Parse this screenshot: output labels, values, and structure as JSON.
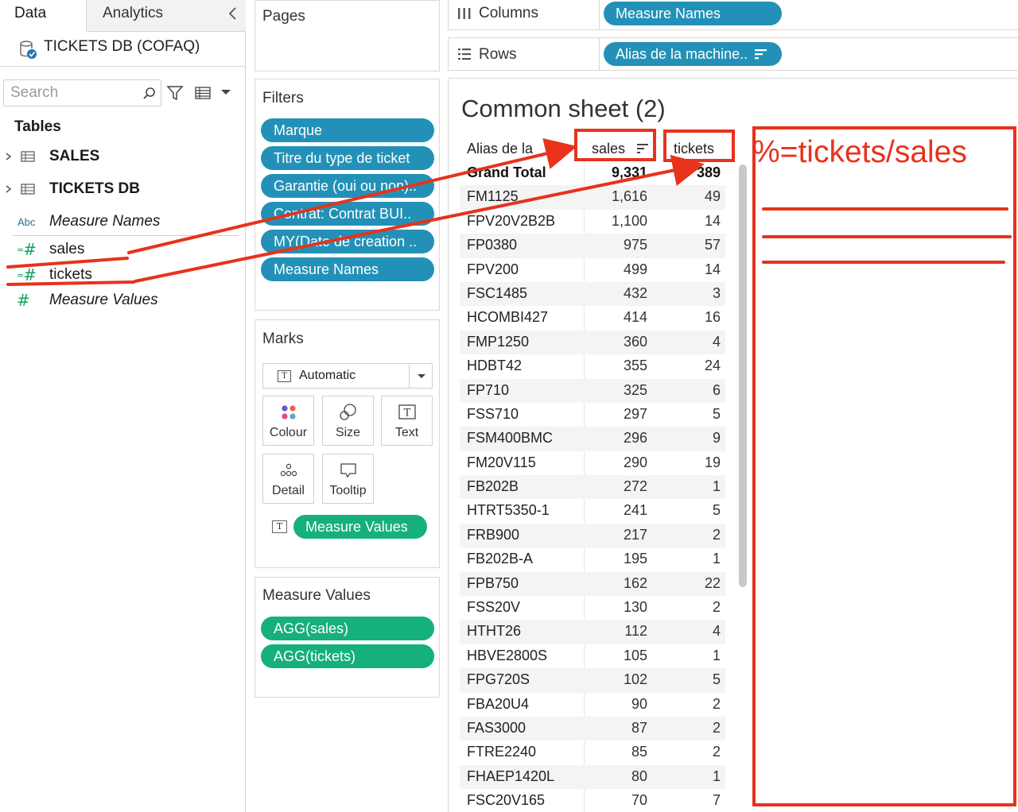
{
  "data_pane": {
    "tab_data": "Data",
    "tab_analytics": "Analytics",
    "datasource": "TICKETS DB (COFAQ)",
    "search_placeholder": "Search",
    "tables_label": "Tables",
    "tables": [
      "SALES",
      "TICKETS DB"
    ],
    "fields": [
      {
        "type": "dimension",
        "label": "Measure Names"
      },
      {
        "type": "calculated-measure",
        "label": "sales"
      },
      {
        "type": "calculated-measure",
        "label": "tickets"
      },
      {
        "type": "measure",
        "label": "Measure Values"
      }
    ],
    "abc_badge": "Abc"
  },
  "shelves": {
    "pages_title": "Pages",
    "filters_title": "Filters",
    "filters": [
      "Marque",
      "Titre du type de ticket",
      "Garantie (oui ou non)..",
      "Contrat: Contrat BUI..",
      "MY(Date de creation ..",
      "Measure Names"
    ],
    "marks_title": "Marks",
    "mark_type": "Automatic",
    "mark_buttons": [
      "Colour",
      "Size",
      "Text",
      "Detail",
      "Tooltip"
    ],
    "text_badge": "T",
    "marks_pill": "Measure Values",
    "measure_values_title": "Measure Values",
    "measure_values": [
      "AGG(sales)",
      "AGG(tickets)"
    ],
    "columns_label": "Columns",
    "columns_pill": "Measure Names",
    "rows_label": "Rows",
    "rows_pill": "Alias de la machine.."
  },
  "view": {
    "sheet_title": "Common sheet (2)",
    "headers": {
      "alias": "Alias de la",
      "sales": "sales",
      "tickets": "tickets"
    },
    "rows": [
      {
        "alias": "Grand Total",
        "sales": "9,331",
        "tickets": "389"
      },
      {
        "alias": "FM1125",
        "sales": "1,616",
        "tickets": "49"
      },
      {
        "alias": "FPV20V2B2B",
        "sales": "1,100",
        "tickets": "14"
      },
      {
        "alias": "FP0380",
        "sales": "975",
        "tickets": "57"
      },
      {
        "alias": "FPV200",
        "sales": "499",
        "tickets": "14"
      },
      {
        "alias": "FSC1485",
        "sales": "432",
        "tickets": "3"
      },
      {
        "alias": "HCOMBI427",
        "sales": "414",
        "tickets": "16"
      },
      {
        "alias": "FMP1250",
        "sales": "360",
        "tickets": "4"
      },
      {
        "alias": "HDBT42",
        "sales": "355",
        "tickets": "24"
      },
      {
        "alias": "FP710",
        "sales": "325",
        "tickets": "6"
      },
      {
        "alias": "FSS710",
        "sales": "297",
        "tickets": "5"
      },
      {
        "alias": "FSM400BMC",
        "sales": "296",
        "tickets": "9"
      },
      {
        "alias": "FM20V115",
        "sales": "290",
        "tickets": "19"
      },
      {
        "alias": "FB202B",
        "sales": "272",
        "tickets": "1"
      },
      {
        "alias": "HTRT5350-1",
        "sales": "241",
        "tickets": "5"
      },
      {
        "alias": "FRB900",
        "sales": "217",
        "tickets": "2"
      },
      {
        "alias": "FB202B-A",
        "sales": "195",
        "tickets": "1"
      },
      {
        "alias": "FPB750",
        "sales": "162",
        "tickets": "22"
      },
      {
        "alias": "FSS20V",
        "sales": "130",
        "tickets": "2"
      },
      {
        "alias": "HTHT26",
        "sales": "112",
        "tickets": "4"
      },
      {
        "alias": "HBVE2800S",
        "sales": "105",
        "tickets": "1"
      },
      {
        "alias": "FPG720S",
        "sales": "102",
        "tickets": "5"
      },
      {
        "alias": "FBA20U4",
        "sales": "90",
        "tickets": "2"
      },
      {
        "alias": "FAS3000",
        "sales": "87",
        "tickets": "2"
      },
      {
        "alias": "FTRE2240",
        "sales": "85",
        "tickets": "2"
      },
      {
        "alias": "FHAEP1420L",
        "sales": "80",
        "tickets": "1"
      },
      {
        "alias": "FSC20V165",
        "sales": "70",
        "tickets": "7"
      }
    ]
  },
  "annotation": {
    "formula": "%=tickets/sales",
    "color": "#e8321c"
  },
  "colors": {
    "pill_blue": "#2391b7",
    "pill_green": "#16b07a",
    "annotation_red": "#e8321c"
  }
}
